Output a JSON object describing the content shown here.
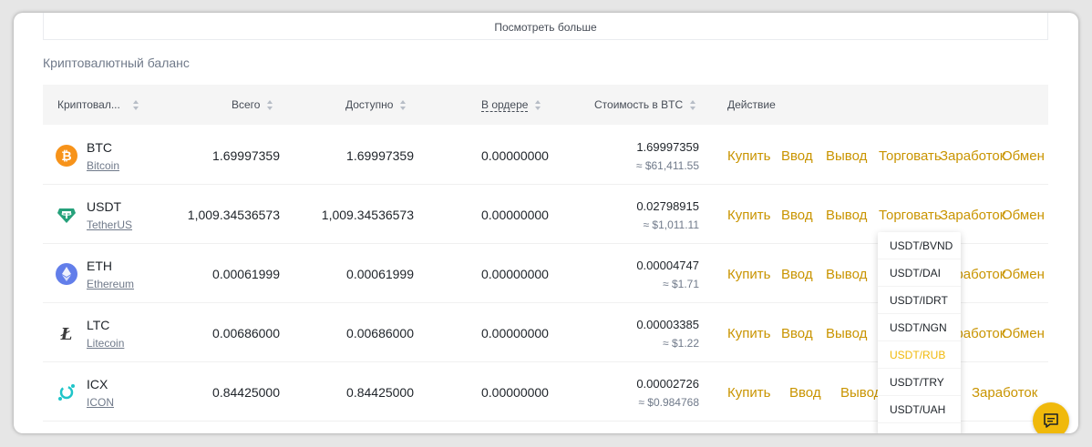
{
  "see_more": "Посмотреть больше",
  "section_title": "Криптовалютный баланс",
  "headers": {
    "coin": "Криптовал...",
    "total": "Всего",
    "available": "Доступно",
    "in_order": "В ордере",
    "btc_value": "Стоимость в BTC",
    "action": "Действие"
  },
  "actions": {
    "buy": "Купить",
    "deposit": "Ввод",
    "withdraw": "Вывод",
    "trade": "Торговать",
    "earn": "Заработок",
    "convert": "Обмен"
  },
  "rows": [
    {
      "symbol": "BTC",
      "name": "Bitcoin",
      "total": "1.69997359",
      "available": "1.69997359",
      "in_order": "0.00000000",
      "btc": "1.69997359",
      "usd": "≈ $61,411.55",
      "icon": "bitcoin-icon",
      "color": "#f7931a"
    },
    {
      "symbol": "USDT",
      "name": "TetherUS",
      "total": "1,009.34536573",
      "available": "1,009.34536573",
      "in_order": "0.00000000",
      "btc": "0.02798915",
      "usd": "≈ $1,011.11",
      "icon": "tether-icon",
      "color": "#26a17b"
    },
    {
      "symbol": "ETH",
      "name": "Ethereum",
      "total": "0.00061999",
      "available": "0.00061999",
      "in_order": "0.00000000",
      "btc": "0.00004747",
      "usd": "≈ $1.71",
      "icon": "ethereum-icon",
      "color": "#627eea"
    },
    {
      "symbol": "LTC",
      "name": "Litecoin",
      "total": "0.00686000",
      "available": "0.00686000",
      "in_order": "0.00000000",
      "btc": "0.00003385",
      "usd": "≈ $1.22",
      "icon": "litecoin-icon",
      "color": "#3c3c3d"
    },
    {
      "symbol": "ICX",
      "name": "ICON",
      "total": "0.84425000",
      "available": "0.84425000",
      "in_order": "0.00000000",
      "btc": "0.00002726",
      "usd": "≈ $0.984768",
      "icon": "icon-coin-icon",
      "color": "#1fc5c9"
    }
  ],
  "trade_dropdown": [
    "USDT/BVND",
    "USDT/DAI",
    "USDT/IDRT",
    "USDT/NGN",
    "USDT/RUB",
    "USDT/TRY",
    "USDT/UAH"
  ],
  "trade_dropdown_active": "USDT/RUB",
  "accent_color": "#f0b90b",
  "action_color": "#c99400"
}
